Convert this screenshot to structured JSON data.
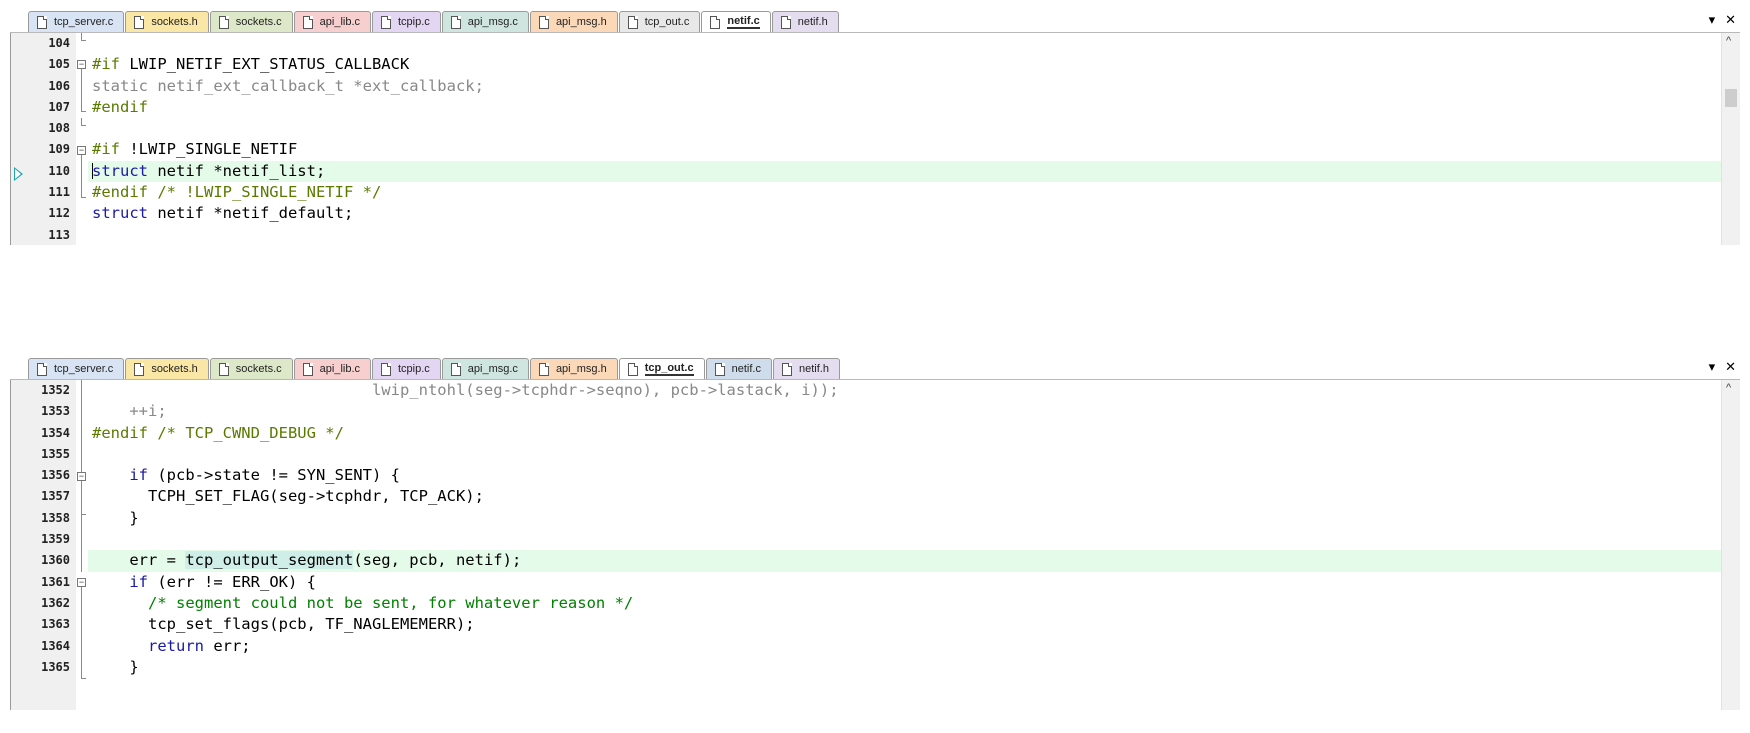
{
  "colors": {
    "tab_tcp_server": "#d8e4f4",
    "tab_sockets_h": "#fbe7a5",
    "tab_sockets_c": "#dde8c8",
    "tab_api_lib": "#f7cfcf",
    "tab_tcpip": "#e3d6f2",
    "tab_api_msg_c": "#cfe6e0",
    "tab_api_msg_h": "#fbd9b8",
    "tab_tcp_out": "#e8e8e8",
    "tab_netif_c": "#cfdcec",
    "tab_netif_h": "#e4dcef",
    "current_line": "#e5fbe9",
    "keyword": "#1a1aa6",
    "preprocessor": "#5a7a00",
    "comment": "#008000"
  },
  "top": {
    "tabs": [
      {
        "label": "tcp_server.c",
        "icon": "document-icon",
        "active": false
      },
      {
        "label": "sockets.h",
        "icon": "document-icon",
        "active": false
      },
      {
        "label": "sockets.c",
        "icon": "document-icon",
        "active": false
      },
      {
        "label": "api_lib.c",
        "icon": "document-icon",
        "active": false
      },
      {
        "label": "tcpip.c",
        "icon": "document-icon",
        "active": false
      },
      {
        "label": "api_msg.c",
        "icon": "document-icon",
        "active": false
      },
      {
        "label": "api_msg.h",
        "icon": "document-icon",
        "active": false
      },
      {
        "label": "tcp_out.c",
        "icon": "document-icon",
        "active": false
      },
      {
        "label": "netif.c",
        "icon": "document-icon",
        "active": true
      },
      {
        "label": "netif.h",
        "icon": "document-icon",
        "active": false
      }
    ],
    "controls": {
      "dropdown": "▾",
      "close": "✕"
    },
    "scroll_arrow": "^",
    "lines": [
      {
        "num": "104",
        "parts": []
      },
      {
        "num": "105",
        "parts": [
          {
            "t": "#if LWIP_NETIF_EXT_STATUS_CALLBACK",
            "c": "ppmix"
          }
        ]
      },
      {
        "num": "106",
        "parts": [
          {
            "t": "static netif_ext_callback_t *ext_callback;",
            "c": "gray"
          }
        ]
      },
      {
        "num": "107",
        "parts": [
          {
            "t": "#endif",
            "c": "pp"
          }
        ]
      },
      {
        "num": "108",
        "parts": []
      },
      {
        "num": "109",
        "parts": [
          {
            "t": "#if !LWIP_SINGLE_NETIF",
            "c": "ppmix2"
          }
        ]
      },
      {
        "num": "110",
        "parts": [
          {
            "t": "struct",
            "c": "kw"
          },
          {
            "t": " netif *netif_list;",
            "c": ""
          }
        ]
      },
      {
        "num": "111",
        "parts": [
          {
            "t": "#endif /* !LWIP_SINGLE_NETIF */",
            "c": "pp"
          }
        ]
      },
      {
        "num": "112",
        "parts": [
          {
            "t": "struct",
            "c": "kw"
          },
          {
            "t": " netif *netif_default;",
            "c": ""
          }
        ]
      },
      {
        "num": "113",
        "parts": []
      }
    ]
  },
  "bottom": {
    "tabs": [
      {
        "label": "tcp_server.c",
        "icon": "document-icon",
        "active": false
      },
      {
        "label": "sockets.h",
        "icon": "document-icon",
        "active": false
      },
      {
        "label": "sockets.c",
        "icon": "document-icon",
        "active": false
      },
      {
        "label": "api_lib.c",
        "icon": "document-icon",
        "active": false
      },
      {
        "label": "tcpip.c",
        "icon": "document-icon",
        "active": false
      },
      {
        "label": "api_msg.c",
        "icon": "document-icon",
        "active": false
      },
      {
        "label": "api_msg.h",
        "icon": "document-icon",
        "active": false
      },
      {
        "label": "tcp_out.c",
        "icon": "document-icon",
        "active": true
      },
      {
        "label": "netif.c",
        "icon": "document-icon",
        "active": false
      },
      {
        "label": "netif.h",
        "icon": "document-icon",
        "active": false
      }
    ],
    "controls": {
      "dropdown": "▾",
      "close": "✕"
    },
    "scroll_arrow": "^",
    "lines": [
      {
        "num": "1352",
        "parts": [
          {
            "t": "                              lwip_ntohl(seg->tcphdr->seqno), pcb->lastack, i));",
            "c": "gray"
          }
        ]
      },
      {
        "num": "1353",
        "parts": [
          {
            "t": "    ++i;",
            "c": "gray"
          }
        ]
      },
      {
        "num": "1354",
        "parts": [
          {
            "t": "#endif /* TCP_CWND_DEBUG */",
            "c": "pp"
          }
        ]
      },
      {
        "num": "1355",
        "parts": []
      },
      {
        "num": "1356",
        "parts": [
          {
            "t": "    if",
            "c": "kw"
          },
          {
            "t": " (pcb->state != SYN_SENT) {",
            "c": ""
          }
        ]
      },
      {
        "num": "1357",
        "parts": [
          {
            "t": "      TCPH_SET_FLAG(seg->tcphdr, TCP_ACK);",
            "c": ""
          }
        ]
      },
      {
        "num": "1358",
        "parts": [
          {
            "t": "    }",
            "c": ""
          }
        ]
      },
      {
        "num": "1359",
        "parts": []
      },
      {
        "num": "1360",
        "parts": [
          {
            "t": "    err = ",
            "c": ""
          },
          {
            "t": "tcp_output_segment",
            "c": "hl"
          },
          {
            "t": "(seg, pcb, netif);",
            "c": ""
          }
        ]
      },
      {
        "num": "1361",
        "parts": [
          {
            "t": "    if",
            "c": "kw"
          },
          {
            "t": " (err != ERR_OK) {",
            "c": ""
          }
        ]
      },
      {
        "num": "1362",
        "parts": [
          {
            "t": "      /* segment could not be sent, for whatever reason */",
            "c": "cm"
          }
        ]
      },
      {
        "num": "1363",
        "parts": [
          {
            "t": "      tcp_set_flags(pcb, TF_NAGLEMEMERR);",
            "c": ""
          }
        ]
      },
      {
        "num": "1364",
        "parts": [
          {
            "t": "      return",
            "c": "kw"
          },
          {
            "t": " err;",
            "c": ""
          }
        ]
      },
      {
        "num": "1365",
        "parts": [
          {
            "t": "    }",
            "c": ""
          }
        ]
      }
    ]
  }
}
